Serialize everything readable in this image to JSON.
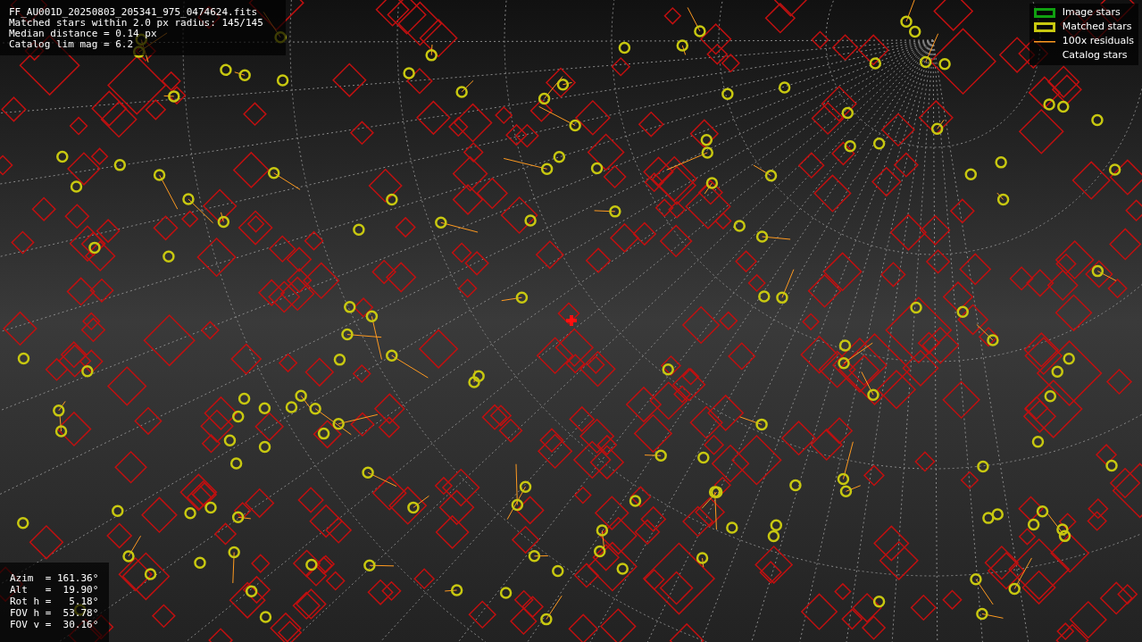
{
  "info": [
    "FF_AU001D_20250803_205341_975_0474624.fits",
    "Matched stars within 2.0 px radius: 145/145",
    "Median distance = 0.14 px",
    "Catalog lim mag = 6.2"
  ],
  "legend": [
    {
      "label": "Image stars",
      "kind": "box",
      "color": "#10a010"
    },
    {
      "label": "Matched stars",
      "kind": "box",
      "color": "#c8c810"
    },
    {
      "label": "100x residuals",
      "kind": "line",
      "color": "#ff9a20"
    },
    {
      "label": "Catalog stars",
      "kind": "blank"
    }
  ],
  "pointing": [
    "Azim  = 161.36°",
    "Alt   =  19.90°",
    "Rot h =   5.18°",
    "FOV h =  53.78°",
    "FOV v =  30.16°"
  ]
}
